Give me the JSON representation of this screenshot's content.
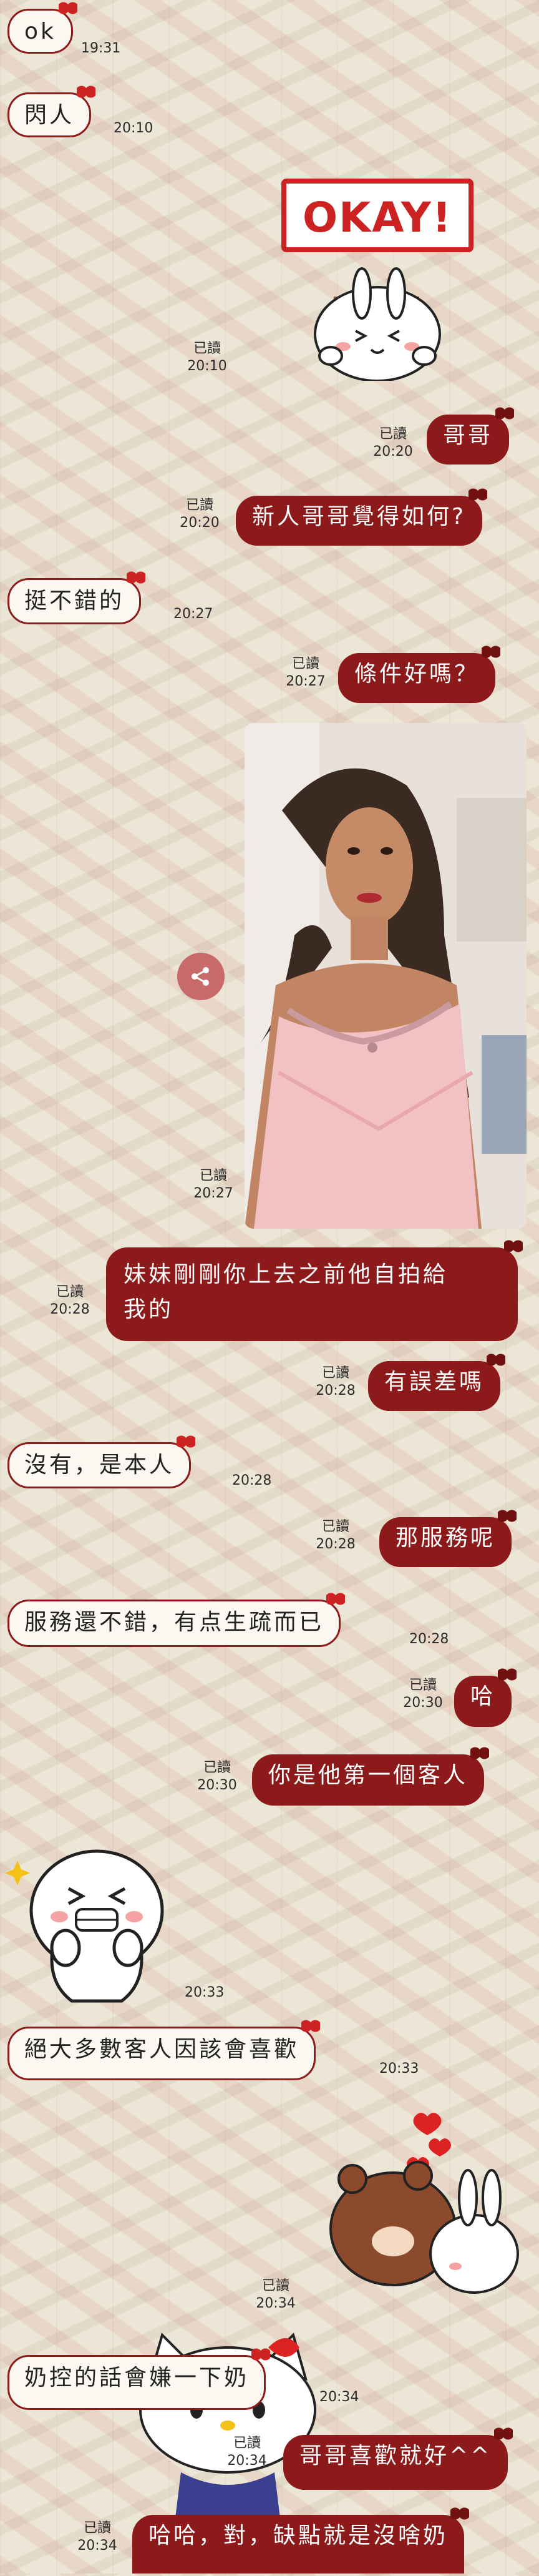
{
  "colors": {
    "outgoing_bubble": "#8d1a1a",
    "incoming_border": "#8c1c1c",
    "incoming_bg": "#fbf8f2"
  },
  "messages": {
    "m1": {
      "text": "ok",
      "time": "19:31"
    },
    "m2": {
      "text": "閃人",
      "time": "20:10"
    },
    "sticker_okay": {
      "text": "OKAY!",
      "read": "已讀",
      "time": "20:10"
    },
    "m3": {
      "text": "哥哥",
      "read": "已讀",
      "time": "20:20"
    },
    "m4": {
      "text": "新人哥哥覺得如何?",
      "read": "已讀",
      "time": "20:20"
    },
    "m5": {
      "text": "挺不錯的",
      "time": "20:27"
    },
    "m6": {
      "text": "條件好嗎？",
      "read": "已讀",
      "time": "20:27"
    },
    "photo": {
      "read": "已讀",
      "time": "20:27",
      "share_icon": "share-icon"
    },
    "m7": {
      "line1": "妹妹剛剛你上去之前他自拍給",
      "line2": "我的",
      "read": "已讀",
      "time": "20:28"
    },
    "m8": {
      "text": "有誤差嗎",
      "read": "已讀",
      "time": "20:28"
    },
    "m9": {
      "text": "沒有，是本人",
      "time": "20:28"
    },
    "m10": {
      "text": "那服務呢",
      "read": "已讀",
      "time": "20:28"
    },
    "m11": {
      "text": "服務還不錯，有点生疏而已",
      "time": "20:28"
    },
    "m12": {
      "text": "哈",
      "read": "已讀",
      "time": "20:30"
    },
    "m13": {
      "text": "你是他第一個客人",
      "read": "已讀",
      "time": "20:30"
    },
    "sticker_laugh": {
      "time": "20:33"
    },
    "m14": {
      "text": "絕大多數客人因該會喜歡",
      "time": "20:33"
    },
    "sticker_hug": {
      "read": "已讀",
      "time": "20:34"
    },
    "m15": {
      "text": "奶控的話會嫌一下奶",
      "time": "20:34"
    },
    "m16": {
      "text": "哥哥喜歡就好^^",
      "read": "已讀",
      "time": "20:34"
    },
    "m17": {
      "text": "哈哈，對，缺點就是沒啥奶",
      "read": "已讀",
      "time": "20:34"
    }
  }
}
